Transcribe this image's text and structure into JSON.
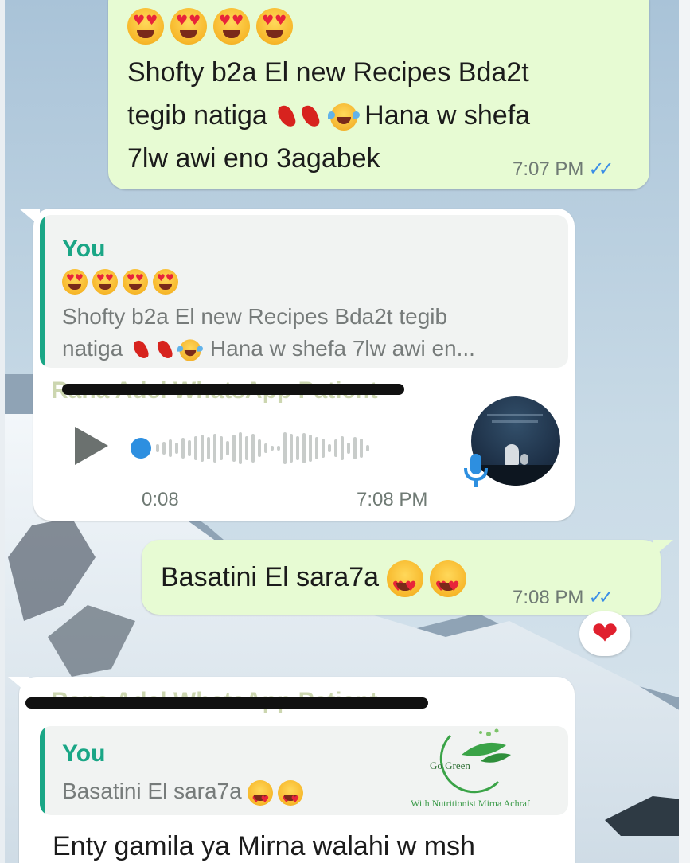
{
  "messages": {
    "m1": {
      "line1": "Shofty b2a El new Recipes Bda2t",
      "line2a": "tegib natiga",
      "line2b": "Hana w shefa",
      "line3": "7lw awi eno 3agabek",
      "time": "7:07 PM",
      "ticks": "✓✓"
    },
    "m2": {
      "quote_author": "You",
      "quote_line1": "Shofty b2a El new Recipes Bda2t tegib",
      "quote_line2a": "natiga",
      "quote_line2b": "Hana w shefa 7lw awi en...",
      "sender": "Rana Adel WhatsApp Patient",
      "duration": "0:08",
      "time": "7:08 PM"
    },
    "m3": {
      "text": "Basatini El sara7a",
      "time": "7:08 PM",
      "ticks": "✓✓",
      "reaction": "❤"
    },
    "m4": {
      "sender": "Rana Adel WhatsApp Patient",
      "quote_author": "You",
      "quote_text": "Basatini El sara7a",
      "text": "Enty gamila ya Mirna walahi w msh"
    }
  },
  "watermark": {
    "title": "Go Green",
    "subtitle": "With Nutritionist Mirna Achraf"
  },
  "colors": {
    "outgoing_bubble": "#e7fbd3",
    "incoming_bubble": "#ffffff",
    "accent_green": "#1aa686",
    "read_ticks": "#3b8ee6",
    "mic_blue": "#2d8fe0"
  },
  "icons": [
    "heart-eyes-emoji",
    "dancer-emoji",
    "laughing-emoji",
    "play-icon",
    "mic-icon",
    "double-check-icon",
    "heart-icon",
    "leaf-logo"
  ]
}
